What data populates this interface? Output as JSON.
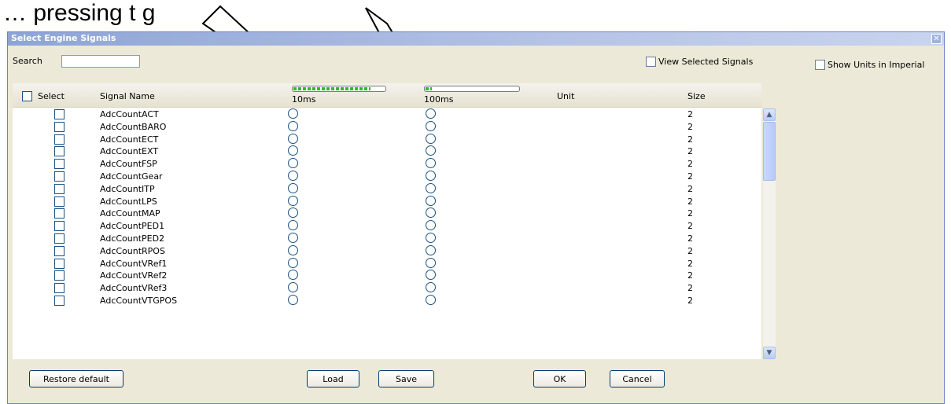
{
  "caption": "…   pressing     t             g",
  "window": {
    "title": "Select Engine Signals",
    "close_glyph": "✕"
  },
  "search": {
    "label": "Search",
    "value": ""
  },
  "view_selected": {
    "label": "View Selected Signals",
    "checked": false
  },
  "show_imperial": {
    "label": "Show Units in Imperial",
    "checked": false
  },
  "table": {
    "headers": {
      "select": "Select",
      "signal_name": "Signal Name",
      "rate_10": "10ms",
      "rate_100": "100ms",
      "unit": "Unit",
      "size": "Size"
    },
    "rate_10_fill": 0.85,
    "rate_100_fill": 0.08,
    "rows": [
      {
        "name": "AdcCountACT",
        "size": "2"
      },
      {
        "name": "AdcCountBARO",
        "size": "2"
      },
      {
        "name": "AdcCountECT",
        "size": "2"
      },
      {
        "name": "AdcCountEXT",
        "size": "2"
      },
      {
        "name": "AdcCountFSP",
        "size": "2"
      },
      {
        "name": "AdcCountGear",
        "size": "2"
      },
      {
        "name": "AdcCountITP",
        "size": "2"
      },
      {
        "name": "AdcCountLPS",
        "size": "2"
      },
      {
        "name": "AdcCountMAP",
        "size": "2"
      },
      {
        "name": "AdcCountPED1",
        "size": "2"
      },
      {
        "name": "AdcCountPED2",
        "size": "2"
      },
      {
        "name": "AdcCountRPOS",
        "size": "2"
      },
      {
        "name": "AdcCountVRef1",
        "size": "2"
      },
      {
        "name": "AdcCountVRef2",
        "size": "2"
      },
      {
        "name": "AdcCountVRef3",
        "size": "2"
      },
      {
        "name": "AdcCountVTGPOS",
        "size": "2"
      }
    ]
  },
  "scroll": {
    "up_glyph": "▲",
    "down_glyph": "▼"
  },
  "buttons": {
    "restore_default": "Restore default",
    "load": "Load",
    "save": "Save",
    "ok": "OK",
    "cancel": "Cancel"
  },
  "colors": {
    "progress_green": "#36b42e",
    "title_blue": "#8ea4d6",
    "window_bg": "#ece9d8"
  }
}
